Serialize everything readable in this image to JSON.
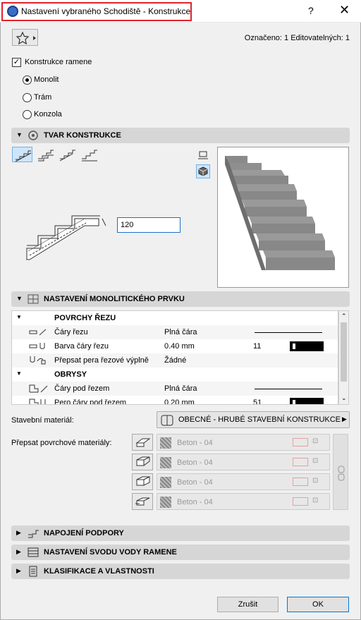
{
  "window": {
    "title": "Nastavení vybraného Schodiště - Konstrukce",
    "help": "?",
    "close": "✕"
  },
  "header": {
    "marked": "Označeno: 1 Editovatelných: 1"
  },
  "structure": {
    "checkbox_label": "Konstrukce ramene",
    "options": [
      "Monolit",
      "Trám",
      "Konzola"
    ],
    "selected": "Monolit"
  },
  "sections": {
    "shape": "TVAR KONSTRUKCE",
    "monolithic": "NASTAVENÍ MONOLITICKÉHO PRVKU",
    "support": "NAPOJENÍ PODPORY",
    "drainage": "NASTAVENÍ SVODU VODY RAMENE",
    "classification": "KLASIFIKACE A VLASTNOSTI"
  },
  "shape": {
    "thickness_value": "120"
  },
  "table": {
    "group1": "POVRCHY ŘEZU",
    "rows1": [
      {
        "label": "Čáry řezu",
        "value": "Plná čára",
        "num": ""
      },
      {
        "label": "Barva čáry řezu",
        "value": "0.40 mm",
        "num": "11"
      },
      {
        "label": "Přepsat pera řezové výplně",
        "value": "Žádné",
        "num": ""
      }
    ],
    "group2": "OBRYSY",
    "rows2": [
      {
        "label": "Čáry pod řezem",
        "value": "Plná čára",
        "num": ""
      },
      {
        "label": "Pero čáry pod řezem",
        "value": "0.20 mm",
        "num": "51"
      }
    ]
  },
  "material": {
    "label": "Stavební materiál:",
    "value": "OBECNÉ - HRUBÉ STAVEBNÍ KONSTRUKCE",
    "override_label": "Přepsat povrchové materiály:",
    "surfaces": [
      "Beton - 04",
      "Beton - 04",
      "Beton - 04",
      "Beton - 04"
    ]
  },
  "buttons": {
    "cancel": "Zrušit",
    "ok": "OK"
  }
}
